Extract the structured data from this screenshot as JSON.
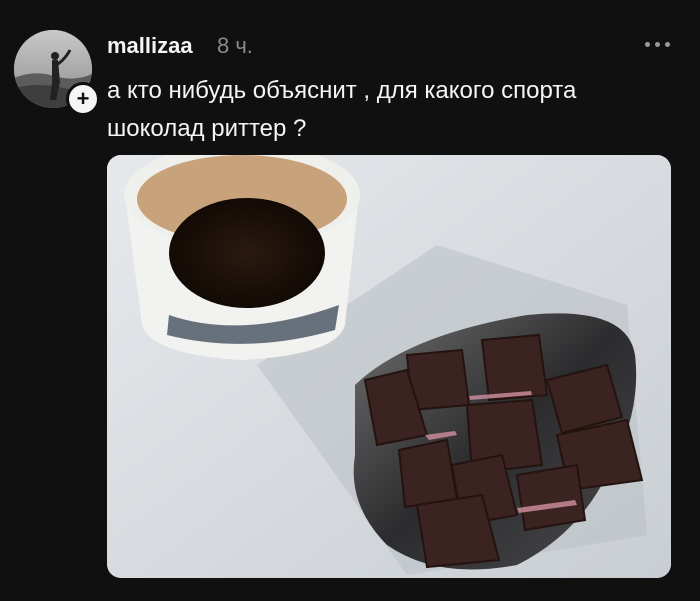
{
  "post": {
    "username": "mallizaa",
    "time": "8 ч.",
    "text": "а кто нибудь объяснит , для какого спорта\nшоколад риттер ?"
  },
  "colors": {
    "background": "#101010",
    "text": "#f5f5f5",
    "muted": "#8a8a8a"
  },
  "icons": {
    "follow": "plus-icon",
    "more": "more-horizontal-icon"
  }
}
